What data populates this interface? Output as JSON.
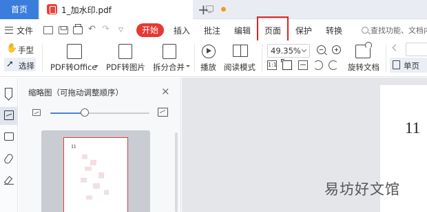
{
  "tabs": {
    "home_label": "首页",
    "doc_title": "1_加水印.pdf"
  },
  "menubar": {
    "file_label": "文件",
    "start_label": "开始",
    "items": [
      "插入",
      "批注",
      "编辑",
      "页面",
      "保护",
      "转换"
    ],
    "highlighted_item": "页面",
    "search_placeholder": "查找功能、文档内容"
  },
  "toolbar": {
    "hand_label": "手型",
    "select_label": "选择",
    "pdf_to_office": "PDF转Office",
    "pdf_to_image": "PDF转图片",
    "split_merge": "拆分合并",
    "play": "播放",
    "read_mode": "阅读模式",
    "zoom": "49.35%",
    "rotate_doc": "旋转文档",
    "single_page": "单页"
  },
  "panel": {
    "title": "缩略图（可拖动调整顺序）",
    "slider_fraction": 0.35,
    "thumb_page_number": "11"
  },
  "document": {
    "page_number": "11"
  },
  "watermark_text": "易坊好文馆",
  "colors": {
    "accent": "#3b7ddd",
    "start_button": "#e53935",
    "highlight_border": "#e02020",
    "pdf_badge": "#e5453a"
  }
}
